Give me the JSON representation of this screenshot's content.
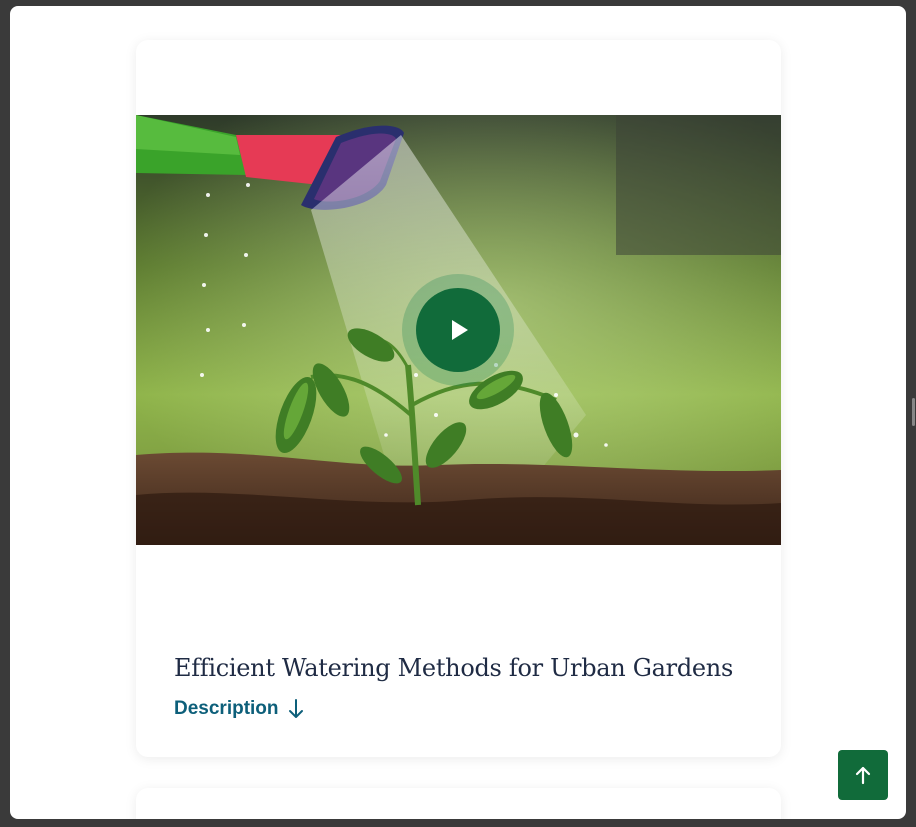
{
  "card": {
    "title": "Efficient Watering Methods for Urban Gardens",
    "description_label": "Description"
  },
  "icons": {
    "play": "play-icon",
    "description_toggle": "arrow-down-icon",
    "scroll_top": "arrow-up-icon"
  },
  "media": {
    "subject": "watering can sprinkling water on a young tomato seedling in soil"
  },
  "colors": {
    "accent_green": "#116b3a",
    "title_text": "#1f2b44",
    "link_text": "#0d5f7a"
  }
}
